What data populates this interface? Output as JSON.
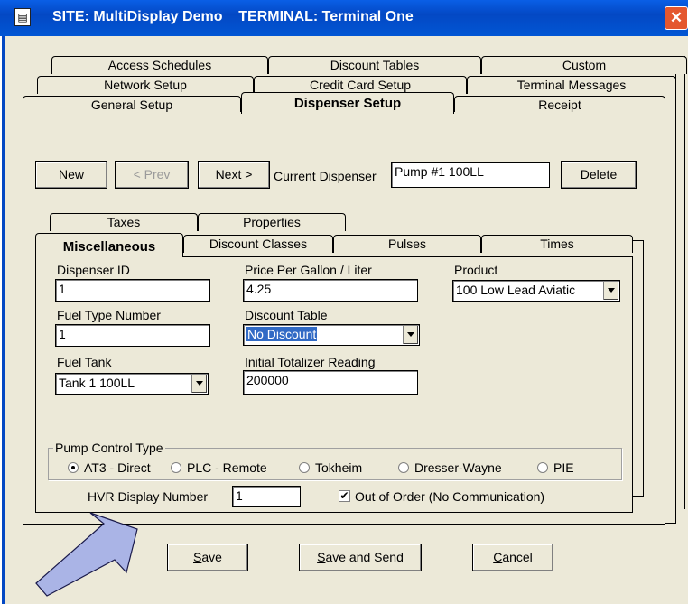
{
  "window": {
    "title": "SITE: MultiDisplay Demo    TERMINAL: Terminal One",
    "icon": "terminal-app-icon",
    "close_glyph": "✕"
  },
  "main_tabs": {
    "row1": [
      "Access Schedules",
      "Discount Tables",
      "Custom"
    ],
    "row2": [
      "Network Setup",
      "Credit Card Setup",
      "Terminal Messages"
    ],
    "row3": [
      "General Setup",
      "Dispenser Setup",
      "Receipt"
    ],
    "active": "Dispenser Setup"
  },
  "dispenser_toolbar": {
    "new_label": "New",
    "prev_label": "< Prev",
    "next_label": "Next >",
    "current_label": "Current Dispenser",
    "current_value": "Pump #1 100LL",
    "delete_label": "Delete"
  },
  "sub_tabs": {
    "row1": [
      "Taxes",
      "Properties"
    ],
    "row2": [
      "Miscellaneous",
      "Discount Classes",
      "Pulses",
      "Times"
    ],
    "active": "Miscellaneous"
  },
  "fields": {
    "dispenser_id_label": "Dispenser ID",
    "dispenser_id_value": "1",
    "price_label": "Price Per Gallon / Liter",
    "price_value": "4.25",
    "product_label": "Product",
    "product_value": "100 Low Lead Aviatic",
    "fuel_type_label": "Fuel Type Number",
    "fuel_type_value": "1",
    "discount_table_label": "Discount Table",
    "discount_table_value": "No Discount",
    "fuel_tank_label": "Fuel Tank",
    "fuel_tank_value": "Tank 1 100LL",
    "totalizer_label": "Initial Totalizer Reading",
    "totalizer_value": "200000"
  },
  "pump_control": {
    "group_label": "Pump Control Type",
    "options": [
      "AT3 - Direct",
      "PLC - Remote",
      "Tokheim",
      "Dresser-Wayne",
      "PIE"
    ],
    "selected": "AT3 - Direct"
  },
  "bottom_row": {
    "hvr_label": "HVR Display Number",
    "hvr_value": "1",
    "out_of_order_label": "Out of Order (No Communication)",
    "out_of_order_checked": true
  },
  "dialog_buttons": {
    "save_accel": "S",
    "save_rest": "ave",
    "save_send_accel": "S",
    "save_send_rest": "ave and Send",
    "cancel_accel": "C",
    "cancel_rest": "ancel"
  },
  "colors": {
    "titlebar": "#0348c4",
    "window_bg": "#ece9d8",
    "selection": "#316ac5",
    "arrow_fill": "#aab4e6"
  }
}
